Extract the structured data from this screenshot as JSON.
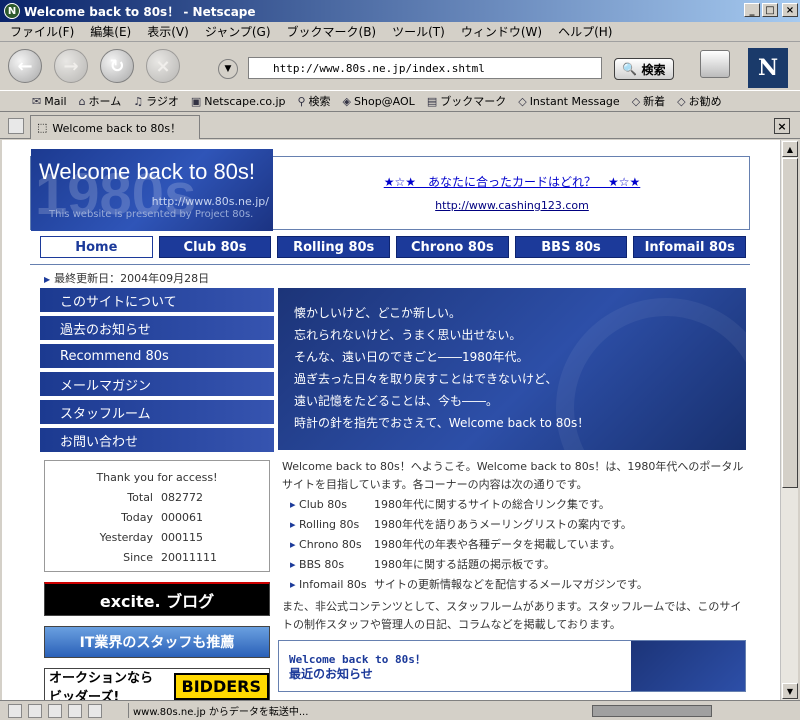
{
  "window": {
    "title": "Welcome back to 80s！ - Netscape"
  },
  "menu": [
    "ファイル(F)",
    "編集(E)",
    "表示(V)",
    "ジャンプ(G)",
    "ブックマーク(B)",
    "ツール(T)",
    "ウィンドウ(W)",
    "ヘルプ(H)"
  ],
  "nav": {
    "url": "http://www.80s.ne.jp/index.shtml",
    "search_label": "検索"
  },
  "personal_toolbar": [
    "Mail",
    "ホーム",
    "ラジオ",
    "Netscape.co.jp",
    "検索",
    "Shop@AOL",
    "ブックマーク",
    "Instant Message",
    "新着",
    "お勧め"
  ],
  "tab": {
    "title": "Welcome back to 80s！"
  },
  "page": {
    "logo_title": "Welcome back to 80s!",
    "logo_big": "1980s",
    "logo_url": "http://www.80s.ne.jp/",
    "logo_sub": "This website is presented by Project 80s.",
    "banner_text": "★☆★　あなたに合ったカードはどれ？　★☆★",
    "banner_url": "http://www.cashing123.com",
    "global_nav": [
      "Home",
      "Club 80s",
      "Rolling 80s",
      "Chrono 80s",
      "BBS 80s",
      "Infomail 80s"
    ],
    "last_updated": "最終更新日：2004年09月28日",
    "side_nav": [
      "このサイトについて",
      "過去のお知らせ",
      "Recommend 80s",
      "メールマガジン",
      "スタッフルーム",
      "お問い合わせ"
    ],
    "hero_lines": [
      "懐かしいけど、どこか新しい。",
      "忘れられないけど、うまく思い出せない。",
      "そんな、遠い日のできごと――1980年代。",
      "過ぎ去った日々を取り戻すことはできないけど、",
      "遠い記憶をたどることは、今も――。",
      "時計の針を指先でおさえて、Welcome back to 80s！"
    ],
    "counter": {
      "thanks": "Thank you for access!",
      "rows": [
        {
          "label": "Total",
          "value": "082772"
        },
        {
          "label": "Today",
          "value": "000061"
        },
        {
          "label": "Yesterday",
          "value": "000115"
        },
        {
          "label": "Since",
          "value": "20011111"
        }
      ]
    },
    "ads": {
      "excite": "excite. ブログ",
      "it": "IT業界のスタッフも推薦",
      "bidders_left": "オークションならビッダーズ!",
      "bidders_right": "BIDDERS"
    },
    "intro": "Welcome back to 80s！へようこそ。Welcome back to 80s！は、1980年代へのポータルサイトを目指しています。各コーナーの内容は次の通りです。",
    "corners": [
      {
        "name": "Club 80s",
        "desc": "1980年代に関するサイトの総合リンク集です。"
      },
      {
        "name": "Rolling 80s",
        "desc": "1980年代を語りあうメーリングリストの案内です。"
      },
      {
        "name": "Chrono 80s",
        "desc": "1980年代の年表や各種データを掲載しています。"
      },
      {
        "name": "BBS  80s",
        "desc": "1980年に関する話題の掲示板です。"
      },
      {
        "name": "Infomail 80s",
        "desc": "サイトの更新情報などを配信するメールマガジンです。"
      }
    ],
    "also": "また、非公式コンテンツとして、スタッフルームがあります。スタッフルームでは、このサイトの制作スタッフや管理人の日記、コラムなどを掲載しております。",
    "news_title": "Welcome back to 80s！",
    "news_sub": "最近のお知らせ"
  },
  "status": {
    "text": "www.80s.ne.jp からデータを転送中..."
  }
}
